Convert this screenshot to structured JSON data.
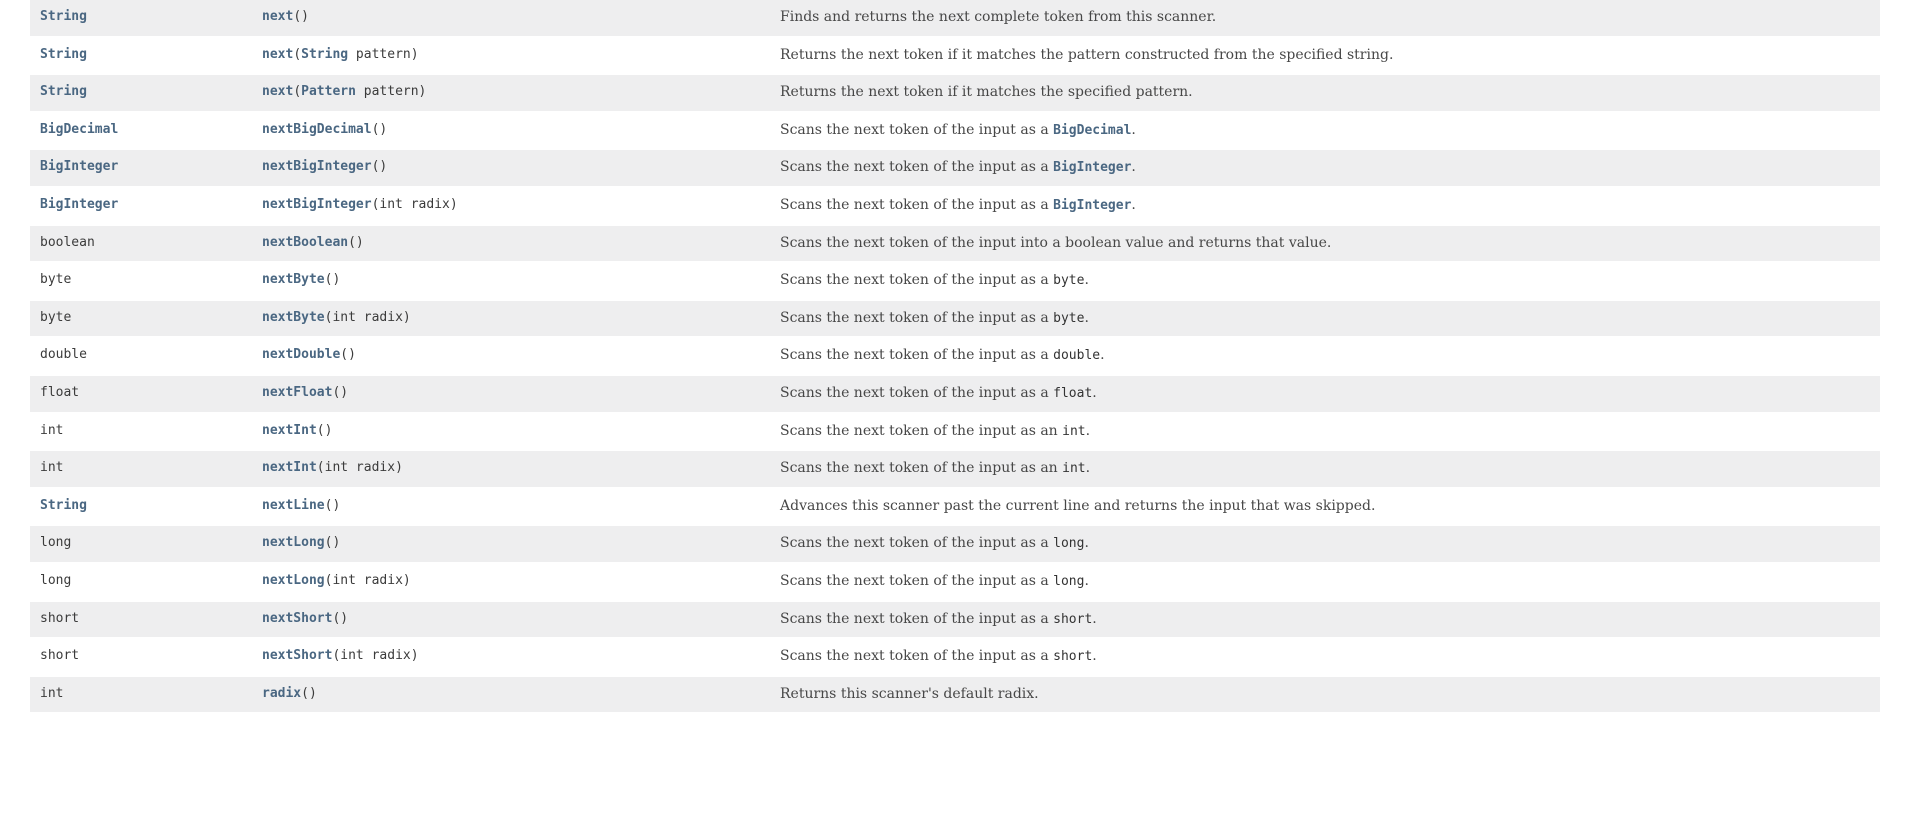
{
  "rows": [
    {
      "retType": "String",
      "retLink": true,
      "method": "next",
      "params": "()",
      "desc": "Finds and returns the next complete token from this scanner."
    },
    {
      "retType": "String",
      "retLink": true,
      "method": "next",
      "paramsPrefix": "(",
      "paramLinkText": "String",
      "paramsSuffix": " pattern)",
      "desc": "Returns the next token if it matches the pattern constructed from the specified string."
    },
    {
      "retType": "String",
      "retLink": true,
      "method": "next",
      "paramsPrefix": "(",
      "paramLinkText": "Pattern",
      "paramsSuffix": " pattern)",
      "desc": "Returns the next token if it matches the specified pattern."
    },
    {
      "retType": "BigDecimal",
      "retLink": true,
      "method": "nextBigDecimal",
      "params": "()",
      "descPrefix": "Scans the next token of the input as a ",
      "descCodeLink": "BigDecimal",
      "descSuffix": "."
    },
    {
      "retType": "BigInteger",
      "retLink": true,
      "method": "nextBigInteger",
      "params": "()",
      "descPrefix": "Scans the next token of the input as a ",
      "descCodeLink": "BigInteger",
      "descSuffix": "."
    },
    {
      "retType": "BigInteger",
      "retLink": true,
      "method": "nextBigInteger",
      "params": "(int radix)",
      "descPrefix": "Scans the next token of the input as a ",
      "descCodeLink": "BigInteger",
      "descSuffix": "."
    },
    {
      "retType": "boolean",
      "retLink": false,
      "method": "nextBoolean",
      "params": "()",
      "desc": "Scans the next token of the input into a boolean value and returns that value."
    },
    {
      "retType": "byte",
      "retLink": false,
      "method": "nextByte",
      "params": "()",
      "descPrefix": "Scans the next token of the input as a ",
      "descCode": "byte",
      "descSuffix": "."
    },
    {
      "retType": "byte",
      "retLink": false,
      "method": "nextByte",
      "params": "(int radix)",
      "descPrefix": "Scans the next token of the input as a ",
      "descCode": "byte",
      "descSuffix": "."
    },
    {
      "retType": "double",
      "retLink": false,
      "method": "nextDouble",
      "params": "()",
      "descPrefix": "Scans the next token of the input as a ",
      "descCode": "double",
      "descSuffix": "."
    },
    {
      "retType": "float",
      "retLink": false,
      "method": "nextFloat",
      "params": "()",
      "descPrefix": "Scans the next token of the input as a ",
      "descCode": "float",
      "descSuffix": "."
    },
    {
      "retType": "int",
      "retLink": false,
      "method": "nextInt",
      "params": "()",
      "descPrefix": "Scans the next token of the input as an ",
      "descCode": "int",
      "descSuffix": "."
    },
    {
      "retType": "int",
      "retLink": false,
      "method": "nextInt",
      "params": "(int radix)",
      "descPrefix": "Scans the next token of the input as an ",
      "descCode": "int",
      "descSuffix": "."
    },
    {
      "retType": "String",
      "retLink": true,
      "method": "nextLine",
      "params": "()",
      "desc": "Advances this scanner past the current line and returns the input that was skipped."
    },
    {
      "retType": "long",
      "retLink": false,
      "method": "nextLong",
      "params": "()",
      "descPrefix": "Scans the next token of the input as a ",
      "descCode": "long",
      "descSuffix": "."
    },
    {
      "retType": "long",
      "retLink": false,
      "method": "nextLong",
      "params": "(int radix)",
      "descPrefix": "Scans the next token of the input as a ",
      "descCode": "long",
      "descSuffix": "."
    },
    {
      "retType": "short",
      "retLink": false,
      "method": "nextShort",
      "params": "()",
      "descPrefix": "Scans the next token of the input as a ",
      "descCode": "short",
      "descSuffix": "."
    },
    {
      "retType": "short",
      "retLink": false,
      "method": "nextShort",
      "params": "(int radix)",
      "descPrefix": "Scans the next token of the input as a ",
      "descCode": "short",
      "descSuffix": "."
    },
    {
      "retType": "int",
      "retLink": false,
      "method": "radix",
      "params": "()",
      "desc": "Returns this scanner's default radix."
    }
  ]
}
